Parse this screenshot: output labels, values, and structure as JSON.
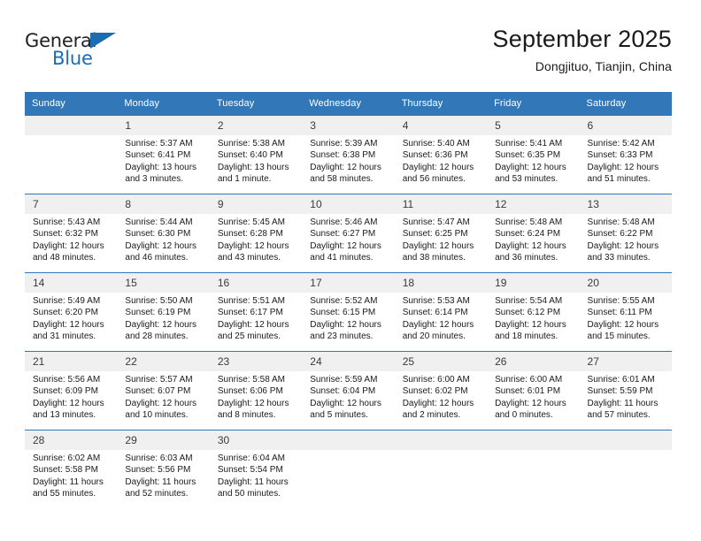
{
  "brand": {
    "word1": "General",
    "word2": "Blue",
    "triangle_color": "#1b6cb3",
    "text_color": "#231f20"
  },
  "header": {
    "title": "September 2025",
    "subtitle": "Dongjituo, Tianjin, China",
    "header_bg": "#3277b8",
    "daynum_bg": "#f0f0f0"
  },
  "weekdays": [
    "Sunday",
    "Monday",
    "Tuesday",
    "Wednesday",
    "Thursday",
    "Friday",
    "Saturday"
  ],
  "weeks": [
    [
      {
        "day": "",
        "sunrise": "",
        "sunset": "",
        "daylight1": "",
        "daylight2": ""
      },
      {
        "day": "1",
        "sunrise": "Sunrise: 5:37 AM",
        "sunset": "Sunset: 6:41 PM",
        "daylight1": "Daylight: 13 hours",
        "daylight2": "and 3 minutes."
      },
      {
        "day": "2",
        "sunrise": "Sunrise: 5:38 AM",
        "sunset": "Sunset: 6:40 PM",
        "daylight1": "Daylight: 13 hours",
        "daylight2": "and 1 minute."
      },
      {
        "day": "3",
        "sunrise": "Sunrise: 5:39 AM",
        "sunset": "Sunset: 6:38 PM",
        "daylight1": "Daylight: 12 hours",
        "daylight2": "and 58 minutes."
      },
      {
        "day": "4",
        "sunrise": "Sunrise: 5:40 AM",
        "sunset": "Sunset: 6:36 PM",
        "daylight1": "Daylight: 12 hours",
        "daylight2": "and 56 minutes."
      },
      {
        "day": "5",
        "sunrise": "Sunrise: 5:41 AM",
        "sunset": "Sunset: 6:35 PM",
        "daylight1": "Daylight: 12 hours",
        "daylight2": "and 53 minutes."
      },
      {
        "day": "6",
        "sunrise": "Sunrise: 5:42 AM",
        "sunset": "Sunset: 6:33 PM",
        "daylight1": "Daylight: 12 hours",
        "daylight2": "and 51 minutes."
      }
    ],
    [
      {
        "day": "7",
        "sunrise": "Sunrise: 5:43 AM",
        "sunset": "Sunset: 6:32 PM",
        "daylight1": "Daylight: 12 hours",
        "daylight2": "and 48 minutes."
      },
      {
        "day": "8",
        "sunrise": "Sunrise: 5:44 AM",
        "sunset": "Sunset: 6:30 PM",
        "daylight1": "Daylight: 12 hours",
        "daylight2": "and 46 minutes."
      },
      {
        "day": "9",
        "sunrise": "Sunrise: 5:45 AM",
        "sunset": "Sunset: 6:28 PM",
        "daylight1": "Daylight: 12 hours",
        "daylight2": "and 43 minutes."
      },
      {
        "day": "10",
        "sunrise": "Sunrise: 5:46 AM",
        "sunset": "Sunset: 6:27 PM",
        "daylight1": "Daylight: 12 hours",
        "daylight2": "and 41 minutes."
      },
      {
        "day": "11",
        "sunrise": "Sunrise: 5:47 AM",
        "sunset": "Sunset: 6:25 PM",
        "daylight1": "Daylight: 12 hours",
        "daylight2": "and 38 minutes."
      },
      {
        "day": "12",
        "sunrise": "Sunrise: 5:48 AM",
        "sunset": "Sunset: 6:24 PM",
        "daylight1": "Daylight: 12 hours",
        "daylight2": "and 36 minutes."
      },
      {
        "day": "13",
        "sunrise": "Sunrise: 5:48 AM",
        "sunset": "Sunset: 6:22 PM",
        "daylight1": "Daylight: 12 hours",
        "daylight2": "and 33 minutes."
      }
    ],
    [
      {
        "day": "14",
        "sunrise": "Sunrise: 5:49 AM",
        "sunset": "Sunset: 6:20 PM",
        "daylight1": "Daylight: 12 hours",
        "daylight2": "and 31 minutes."
      },
      {
        "day": "15",
        "sunrise": "Sunrise: 5:50 AM",
        "sunset": "Sunset: 6:19 PM",
        "daylight1": "Daylight: 12 hours",
        "daylight2": "and 28 minutes."
      },
      {
        "day": "16",
        "sunrise": "Sunrise: 5:51 AM",
        "sunset": "Sunset: 6:17 PM",
        "daylight1": "Daylight: 12 hours",
        "daylight2": "and 25 minutes."
      },
      {
        "day": "17",
        "sunrise": "Sunrise: 5:52 AM",
        "sunset": "Sunset: 6:15 PM",
        "daylight1": "Daylight: 12 hours",
        "daylight2": "and 23 minutes."
      },
      {
        "day": "18",
        "sunrise": "Sunrise: 5:53 AM",
        "sunset": "Sunset: 6:14 PM",
        "daylight1": "Daylight: 12 hours",
        "daylight2": "and 20 minutes."
      },
      {
        "day": "19",
        "sunrise": "Sunrise: 5:54 AM",
        "sunset": "Sunset: 6:12 PM",
        "daylight1": "Daylight: 12 hours",
        "daylight2": "and 18 minutes."
      },
      {
        "day": "20",
        "sunrise": "Sunrise: 5:55 AM",
        "sunset": "Sunset: 6:11 PM",
        "daylight1": "Daylight: 12 hours",
        "daylight2": "and 15 minutes."
      }
    ],
    [
      {
        "day": "21",
        "sunrise": "Sunrise: 5:56 AM",
        "sunset": "Sunset: 6:09 PM",
        "daylight1": "Daylight: 12 hours",
        "daylight2": "and 13 minutes."
      },
      {
        "day": "22",
        "sunrise": "Sunrise: 5:57 AM",
        "sunset": "Sunset: 6:07 PM",
        "daylight1": "Daylight: 12 hours",
        "daylight2": "and 10 minutes."
      },
      {
        "day": "23",
        "sunrise": "Sunrise: 5:58 AM",
        "sunset": "Sunset: 6:06 PM",
        "daylight1": "Daylight: 12 hours",
        "daylight2": "and 8 minutes."
      },
      {
        "day": "24",
        "sunrise": "Sunrise: 5:59 AM",
        "sunset": "Sunset: 6:04 PM",
        "daylight1": "Daylight: 12 hours",
        "daylight2": "and 5 minutes."
      },
      {
        "day": "25",
        "sunrise": "Sunrise: 6:00 AM",
        "sunset": "Sunset: 6:02 PM",
        "daylight1": "Daylight: 12 hours",
        "daylight2": "and 2 minutes."
      },
      {
        "day": "26",
        "sunrise": "Sunrise: 6:00 AM",
        "sunset": "Sunset: 6:01 PM",
        "daylight1": "Daylight: 12 hours",
        "daylight2": "and 0 minutes."
      },
      {
        "day": "27",
        "sunrise": "Sunrise: 6:01 AM",
        "sunset": "Sunset: 5:59 PM",
        "daylight1": "Daylight: 11 hours",
        "daylight2": "and 57 minutes."
      }
    ],
    [
      {
        "day": "28",
        "sunrise": "Sunrise: 6:02 AM",
        "sunset": "Sunset: 5:58 PM",
        "daylight1": "Daylight: 11 hours",
        "daylight2": "and 55 minutes."
      },
      {
        "day": "29",
        "sunrise": "Sunrise: 6:03 AM",
        "sunset": "Sunset: 5:56 PM",
        "daylight1": "Daylight: 11 hours",
        "daylight2": "and 52 minutes."
      },
      {
        "day": "30",
        "sunrise": "Sunrise: 6:04 AM",
        "sunset": "Sunset: 5:54 PM",
        "daylight1": "Daylight: 11 hours",
        "daylight2": "and 50 minutes."
      },
      {
        "day": "",
        "sunrise": "",
        "sunset": "",
        "daylight1": "",
        "daylight2": ""
      },
      {
        "day": "",
        "sunrise": "",
        "sunset": "",
        "daylight1": "",
        "daylight2": ""
      },
      {
        "day": "",
        "sunrise": "",
        "sunset": "",
        "daylight1": "",
        "daylight2": ""
      },
      {
        "day": "",
        "sunrise": "",
        "sunset": "",
        "daylight1": "",
        "daylight2": ""
      }
    ]
  ]
}
